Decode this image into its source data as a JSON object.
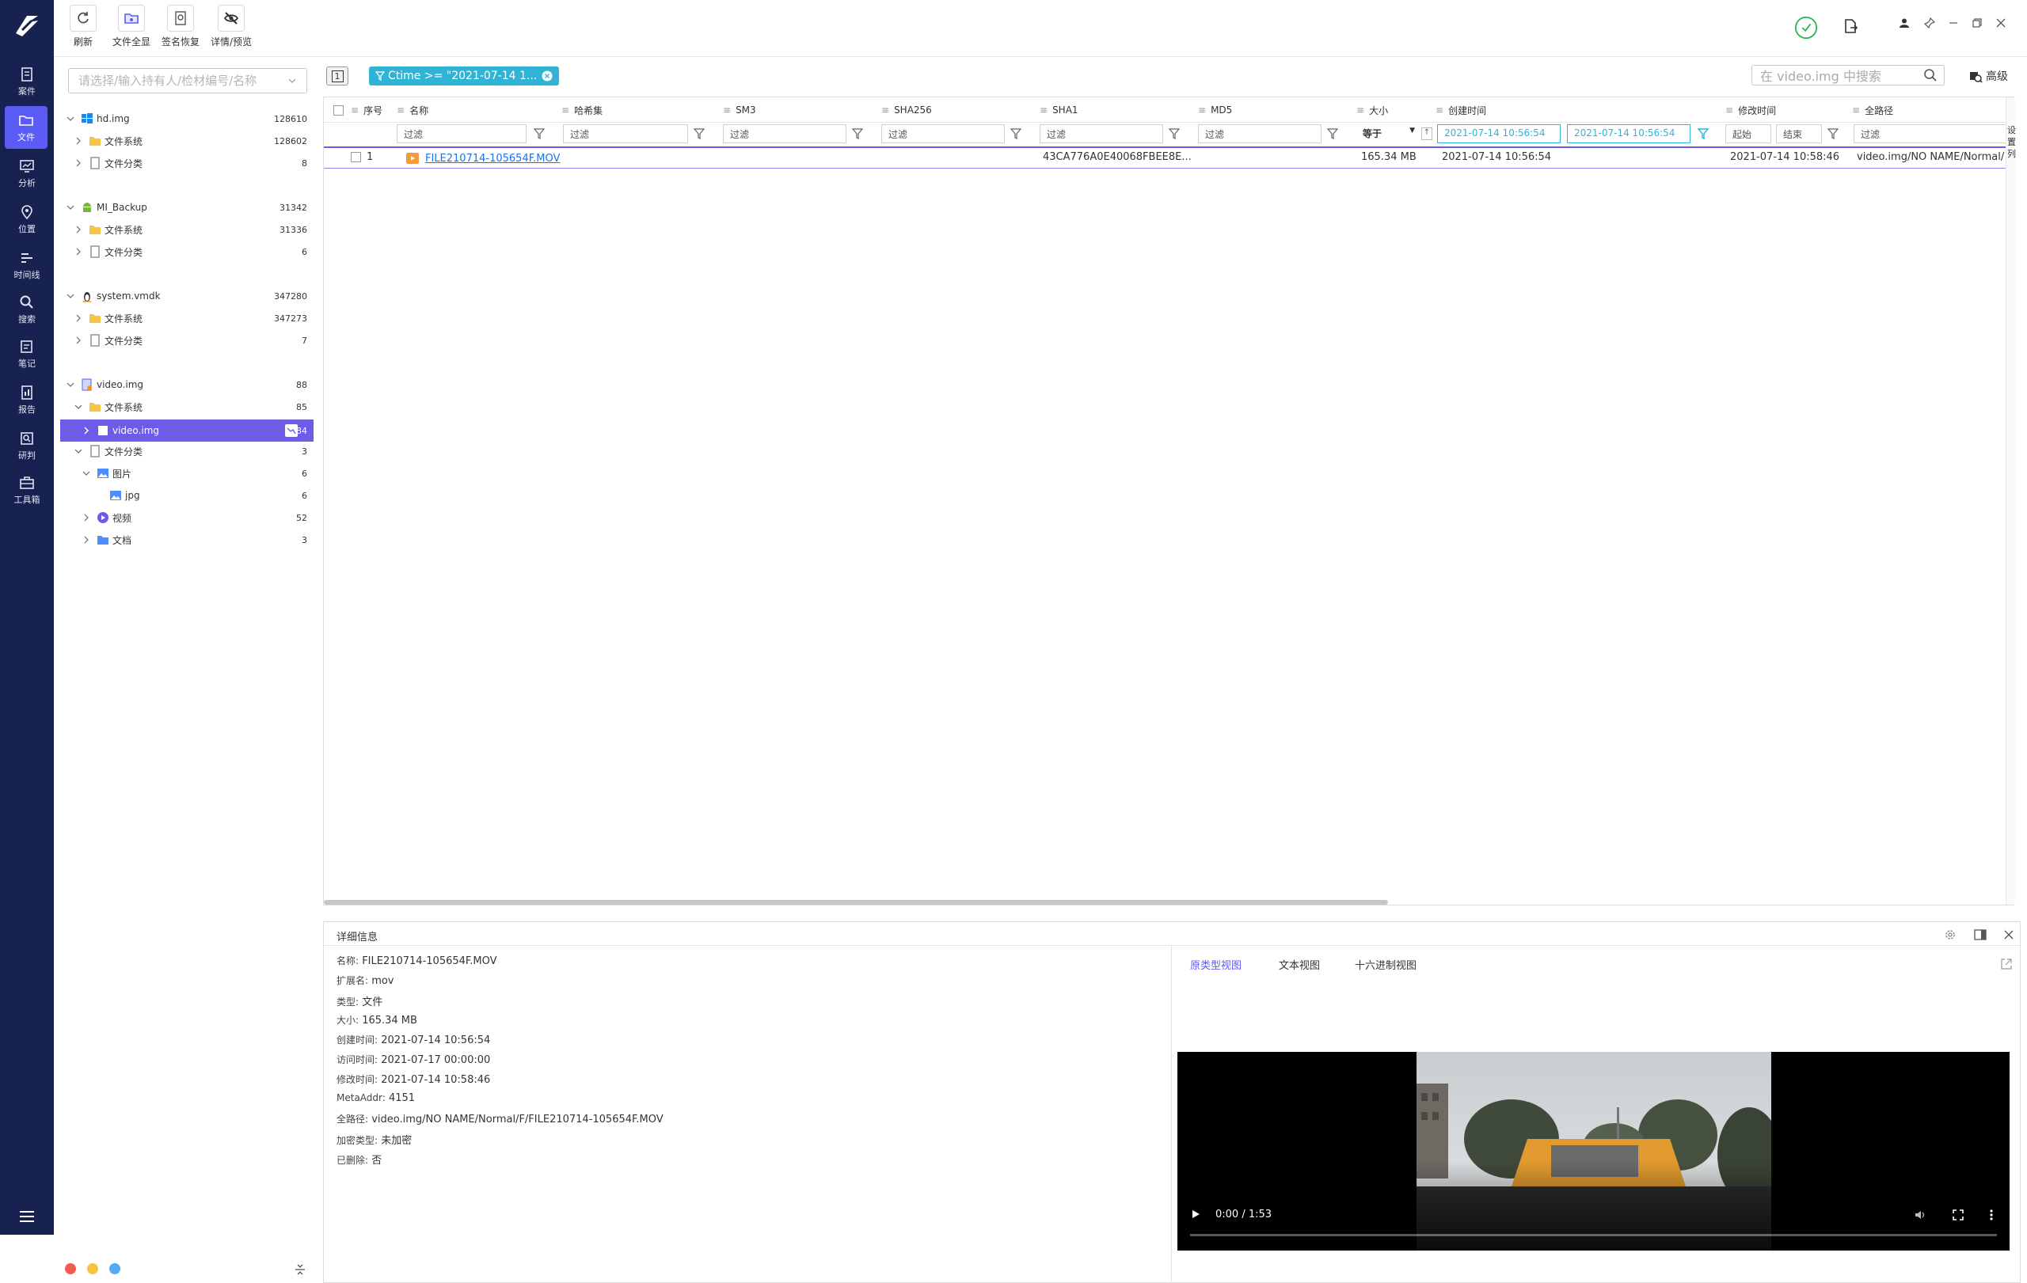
{
  "toolbar": {
    "buttons": [
      {
        "label": "刷新",
        "icon": "refresh-icon"
      },
      {
        "label": "文件全显",
        "icon": "folder-show-all-icon"
      },
      {
        "label": "签名恢复",
        "icon": "signature-restore-icon"
      },
      {
        "label": "详情/预览",
        "icon": "eye-off-icon"
      }
    ]
  },
  "nav": {
    "items": [
      {
        "label": "案件",
        "icon": "case-icon"
      },
      {
        "label": "文件",
        "icon": "file-icon",
        "active": true
      },
      {
        "label": "分析",
        "icon": "analysis-icon"
      },
      {
        "label": "位置",
        "icon": "location-icon"
      },
      {
        "label": "时间线",
        "icon": "timeline-icon"
      },
      {
        "label": "搜索",
        "icon": "search-icon"
      },
      {
        "label": "笔记",
        "icon": "notes-icon"
      },
      {
        "label": "报告",
        "icon": "report-icon"
      },
      {
        "label": "研判",
        "icon": "judgement-icon"
      },
      {
        "label": "工具箱",
        "icon": "toolbox-icon"
      }
    ]
  },
  "tree": {
    "search_placeholder": "请选择/输入持有人/检材编号/名称",
    "nodes": [
      {
        "label": "hd.img",
        "count": "128610"
      },
      {
        "label": "文件系统",
        "count": "128602"
      },
      {
        "label": "文件分类",
        "count": "8"
      },
      {
        "label": "MI_Backup",
        "count": "31342"
      },
      {
        "label": "文件系统",
        "count": "31336"
      },
      {
        "label": "文件分类",
        "count": "6"
      },
      {
        "label": "system.vmdk",
        "count": "347280"
      },
      {
        "label": "文件系统",
        "count": "347273"
      },
      {
        "label": "文件分类",
        "count": "7"
      },
      {
        "label": "video.img",
        "count": "88"
      },
      {
        "label": "文件系统",
        "count": "85"
      },
      {
        "label": "video.img",
        "count": "84"
      },
      {
        "label": "文件分类",
        "count": "3"
      },
      {
        "label": "图片",
        "count": "6"
      },
      {
        "label": "jpg",
        "count": "6"
      },
      {
        "label": "视频",
        "count": "52"
      },
      {
        "label": "文档",
        "count": "3"
      }
    ]
  },
  "filter_bar": {
    "page_indicator": "1",
    "active_filter": "Ctime >= \"2021-07-14 1...",
    "search_placeholder": "在 video.img 中搜索",
    "advanced_label": "高级",
    "settings_columns_label": "设置列"
  },
  "grid": {
    "columns": [
      "序号",
      "名称",
      "哈希集",
      "SM3",
      "SHA256",
      "SHA1",
      "MD5",
      "大小",
      "创建时间",
      "修改时间",
      "全路径"
    ],
    "filter_placeholder": "过滤",
    "size_operator": "等于",
    "ctime_from": "2021-07-14 10:56:54",
    "ctime_to": "2021-07-14 10:56:54",
    "mtime_start": "起始",
    "mtime_end": "结束",
    "rows": [
      {
        "index": "1",
        "name": "FILE210714-105654F.MOV",
        "sha1": "43CA776A0E40068FBEE8E...",
        "size": "165.34 MB",
        "ctime": "2021-07-14 10:56:54",
        "mtime": "2021-07-14 10:58:46",
        "path": "video.img/NO NAME/Normal/"
      }
    ]
  },
  "detail": {
    "title": "详细信息",
    "fields": [
      {
        "key": "名称:",
        "value": "FILE210714-105654F.MOV"
      },
      {
        "key": "扩展名:",
        "value": "mov"
      },
      {
        "key": "类型:",
        "value": "文件"
      },
      {
        "key": "大小:",
        "value": "165.34 MB"
      },
      {
        "key": "创建时间:",
        "value": "2021-07-14 10:56:54"
      },
      {
        "key": "访问时间:",
        "value": "2021-07-17 00:00:00"
      },
      {
        "key": "修改时间:",
        "value": "2021-07-14 10:58:46"
      },
      {
        "key": "MetaAddr:",
        "value": "4151"
      },
      {
        "key": "全路径:",
        "value": "video.img/NO NAME/Normal/F/FILE210714-105654F.MOV"
      },
      {
        "key": "加密类型:",
        "value": "未加密"
      },
      {
        "key": "已删除:",
        "value": "否"
      }
    ],
    "tabs": [
      "原类型视图",
      "文本视图",
      "十六进制视图"
    ],
    "active_tab": "原类型视图",
    "video_time": "0:00 / 1:53"
  },
  "colors": {
    "rail_bg": "#182251",
    "accent": "#5b5bf5",
    "filter_chip": "#2fb4d6",
    "link": "#1a73e8",
    "selected_tree": "#6c5ce7"
  }
}
